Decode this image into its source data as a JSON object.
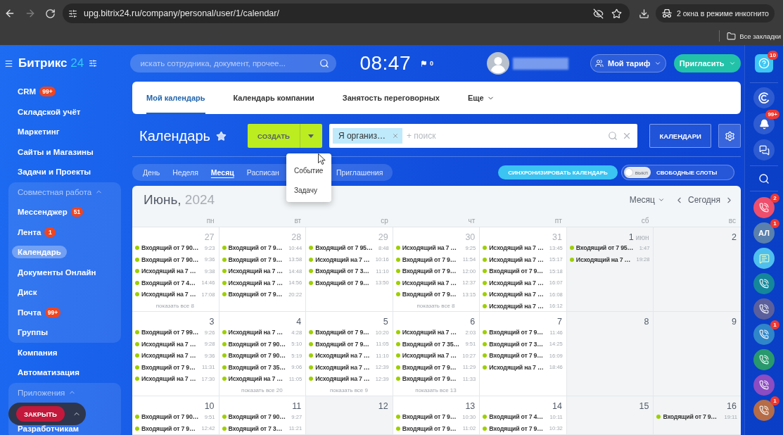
{
  "browser": {
    "url": "upg.bitrix24.ru/company/personal/user/1/calendar/",
    "incognito": "2 окна в режиме инкогнито",
    "bookmarks": "Все закладки"
  },
  "header": {
    "logo_name": "Битрикс",
    "logo_suffix": "24",
    "search_placeholder": "искать сотрудника, документ, прочее...",
    "clock": "08:47",
    "flag_count": "0",
    "tariff_button": "Мой тариф",
    "invite_button": "Пригласить"
  },
  "sidebar": {
    "items": [
      {
        "label": "CRM",
        "badge": "99+",
        "selected": false
      },
      {
        "label": "Складской учёт",
        "selected": false
      },
      {
        "label": "Маркетинг",
        "selected": false
      },
      {
        "label": "Сайты и Магазины",
        "selected": false
      },
      {
        "label": "Задачи и Проекты",
        "selected": false
      },
      {
        "kind": "group",
        "label": "Совместная работа",
        "expanded": true,
        "children": [
          {
            "label": "Мессенджер",
            "badge": "51",
            "selected": false
          },
          {
            "label": "Лента",
            "badge": "1",
            "selected": false
          },
          {
            "label": "Календарь",
            "selected": true
          },
          {
            "label": "Документы Онлайн",
            "selected": false
          },
          {
            "label": "Диск",
            "selected": false
          },
          {
            "label": "Почта",
            "badge": "99+",
            "selected": false
          },
          {
            "label": "Группы",
            "selected": false
          }
        ]
      },
      {
        "label": "Компания",
        "selected": false
      },
      {
        "label": "Автоматизация",
        "selected": false
      },
      {
        "kind": "group",
        "label": "Приложения",
        "expanded": true,
        "children": [
          {
            "label": "Разработчикам",
            "selected": false
          }
        ]
      }
    ]
  },
  "floating_bar": {
    "close_button": "ЗАКРЫТЬ"
  },
  "top_tabs": [
    {
      "kind": "tab",
      "label": "Мой календарь",
      "selected": true
    },
    {
      "kind": "tab",
      "label": "Календарь компании",
      "selected": false
    },
    {
      "kind": "tab",
      "label": "Занятость переговорных",
      "selected": false
    },
    {
      "kind": "more",
      "label": "Еще",
      "selected": false
    }
  ],
  "toolbar": {
    "title": "Календарь",
    "create_button": "СОЗДАТЬ",
    "create_menu": {
      "open": true,
      "items": [
        "Событие",
        "Задачу"
      ]
    },
    "filter": {
      "tags": [
        "Я организ…"
      ],
      "placeholder": "+ поиск"
    },
    "calendars_button": "КАЛЕНДАРИ"
  },
  "view_tabs": [
    {
      "label": "День",
      "selected": false
    },
    {
      "label": "Неделя",
      "selected": false
    },
    {
      "label": "Месяц",
      "selected": true
    },
    {
      "label": "Расписан",
      "selected": false
    },
    {
      "label": "Приглашения",
      "selected": false
    }
  ],
  "sync_button": "СИНХРОНИЗИРОВАТЬ КАЛЕНДАРЬ",
  "free_slots": {
    "switch_label": "выкл",
    "on": false,
    "label": "СВОБОДНЫЕ СЛОТЫ"
  },
  "calendar": {
    "month": "Июнь,",
    "year": "2024",
    "view_select": "Месяц",
    "today_button": "Сегодня",
    "weekdays": [
      "пн",
      "вт",
      "ср",
      "чт",
      "пт",
      "сб",
      "вс"
    ],
    "weeks": [
      [
        {
          "day": "27",
          "other_month": true,
          "day_off": false,
          "events": [
            {
              "title": "Входящий от 7 90…",
              "time": "9:23"
            },
            {
              "title": "Входящий от 7 90…",
              "time": "9:36"
            },
            {
              "title": "Исходящий на 7 …",
              "time": "9:38"
            },
            {
              "title": "Входящий от 7 4…",
              "time": "14:46"
            },
            {
              "title": "Исходящий на 7 …",
              "time": "17:08"
            }
          ],
          "more": "показать все 8"
        },
        {
          "day": "28",
          "other_month": true,
          "day_off": false,
          "events": [
            {
              "title": "Входящий от 7 9…",
              "time": "10:44"
            },
            {
              "title": "Входящий от 7 9…",
              "time": "13:58"
            },
            {
              "title": "Исходящий на 7 …",
              "time": "14:48"
            },
            {
              "title": "Исходящий на 7 …",
              "time": "14:56"
            },
            {
              "title": "Входящий от 7 9…",
              "time": "20:22"
            }
          ]
        },
        {
          "day": "29",
          "other_month": true,
          "day_off": false,
          "events": [
            {
              "title": "Входящий от 7 95…",
              "time": "8:48"
            },
            {
              "title": "Исходящий на 7 …",
              "time": "10:16"
            },
            {
              "title": "Входящий от 7 3…",
              "time": "11:10"
            },
            {
              "title": "Входящий от 7 9…",
              "time": "13:50"
            }
          ]
        },
        {
          "day": "30",
          "other_month": true,
          "day_off": false,
          "events": [
            {
              "title": "Исходящий на 7 …",
              "time": "9:25"
            },
            {
              "title": "Входящий от 7 9…",
              "time": "11:54"
            },
            {
              "title": "Входящий от 7 9…",
              "time": "12:00"
            },
            {
              "title": "Исходящий на 7 …",
              "time": "12:37"
            },
            {
              "title": "Входящий от 7 9…",
              "time": "13:15"
            }
          ],
          "more": "показать все 8"
        },
        {
          "day": "31",
          "other_month": true,
          "day_off": false,
          "events": [
            {
              "title": "Исходящий на 7 …",
              "time": "13:45"
            },
            {
              "title": "Исходящий на 7 …",
              "time": "15:17"
            },
            {
              "title": "Входящий от 7 9…",
              "time": "15:18"
            },
            {
              "title": "Исходящий на 7 …",
              "time": "16:07"
            },
            {
              "title": "Исходящий на 7 …",
              "time": "16:08"
            },
            {
              "title": "Исходящий на 7 …",
              "time": "16:12"
            }
          ]
        },
        {
          "day": "1",
          "month_label": "июн",
          "other_month": false,
          "day_off": true,
          "events": [
            {
              "title": "Входящий от 7 95…",
              "time": "1:47"
            },
            {
              "title": "Исходящий на 7 …",
              "time": "19:28"
            }
          ]
        },
        {
          "day": "2",
          "other_month": false,
          "day_off": true
        }
      ],
      [
        {
          "day": "3",
          "other_month": false,
          "day_off": false,
          "events": [
            {
              "title": "Входящий от 7 99…",
              "time": "9:26"
            },
            {
              "title": "Исходящий на 7 …",
              "time": "9:28"
            },
            {
              "title": "Исходящий на 7 …",
              "time": "9:36"
            },
            {
              "title": "Входящий от 7 9…",
              "time": "11:31"
            },
            {
              "title": "Исходящий на 7 …",
              "time": "17:30"
            }
          ]
        },
        {
          "day": "4",
          "other_month": false,
          "day_off": false,
          "events": [
            {
              "title": "Исходящий на 7 …",
              "time": "4:28"
            },
            {
              "title": "Входящий от 7 90…",
              "time": "5:10"
            },
            {
              "title": "Входящий от 7 90…",
              "time": "5:19"
            },
            {
              "title": "Входящий от 7 35…",
              "time": "9:06"
            },
            {
              "title": "Исходящий на 7 …",
              "time": "11:05"
            }
          ],
          "more": "показать все 20"
        },
        {
          "day": "5",
          "other_month": false,
          "day_off": false,
          "events": [
            {
              "title": "Входящий от 7 9…",
              "time": "10:20"
            },
            {
              "title": "Входящий от 7 9…",
              "time": "11:05"
            },
            {
              "title": "Исходящий на 7 …",
              "time": "11:10"
            },
            {
              "title": "Исходящий на 7 …",
              "time": "12:39"
            },
            {
              "title": "Исходящий на 7 …",
              "time": "12:39"
            }
          ],
          "more": "показать все 9"
        },
        {
          "day": "6",
          "other_month": false,
          "day_off": false,
          "events": [
            {
              "title": "Исходящий на 7 …",
              "time": "2:03"
            },
            {
              "title": "Входящий от 7 35…",
              "time": "9:51"
            },
            {
              "title": "Исходящий на 7 …",
              "time": "10:27"
            },
            {
              "title": "Входящий от 7 9…",
              "time": "11:29"
            },
            {
              "title": "Входящий от 7 9…",
              "time": "11:33"
            }
          ],
          "more": "показать все 13"
        },
        {
          "day": "7",
          "other_month": false,
          "day_off": false,
          "events": [
            {
              "title": "Входящий от 7 9…",
              "time": "11:46"
            },
            {
              "title": "Входящий от 7 3…",
              "time": "14:25"
            },
            {
              "title": "Входящий от 7 9…",
              "time": "16:09"
            },
            {
              "title": "Исходящий на 7 …",
              "time": "18:46"
            }
          ]
        },
        {
          "day": "8",
          "other_month": false,
          "day_off": true
        },
        {
          "day": "9",
          "other_month": false,
          "day_off": true
        }
      ],
      [
        {
          "day": "10",
          "other_month": false,
          "day_off": false,
          "events": [
            {
              "title": "Входящий от 7 90…",
              "time": "9:51"
            },
            {
              "title": "Входящий от 7 9…",
              "time": "12:42"
            }
          ]
        },
        {
          "day": "11",
          "other_month": false,
          "day_off": false,
          "events": [
            {
              "title": "Входящий от 7 90…",
              "time": "9:27"
            },
            {
              "title": "Входящий от 7 3…",
              "time": "11:21"
            }
          ]
        },
        {
          "day": "12",
          "other_month": false,
          "day_off": true
        },
        {
          "day": "13",
          "other_month": false,
          "day_off": false,
          "events": [
            {
              "title": "Входящий от 7 9…",
              "time": "10:30"
            },
            {
              "title": "Входящий от 7 9…",
              "time": "11:02"
            }
          ]
        },
        {
          "day": "14",
          "other_month": false,
          "day_off": false,
          "events": [
            {
              "title": "Входящий от 7 4…",
              "time": "10:11"
            },
            {
              "title": "Входящий от 7 9…",
              "time": "10:32"
            }
          ]
        },
        {
          "day": "15",
          "other_month": false,
          "day_off": true
        },
        {
          "day": "16",
          "other_month": false,
          "day_off": true,
          "events": [
            {
              "title": "Входящий от 7 9…",
              "time": "19:11"
            }
          ]
        }
      ]
    ]
  },
  "right_rail": {
    "help_badge": "10",
    "tools": [
      {
        "kind": "assistant"
      },
      {
        "kind": "bell",
        "badge": "99+"
      },
      {
        "kind": "chat"
      }
    ],
    "contacts": [
      {
        "kind": "phone",
        "color": "#ee4f6c",
        "badge": "2"
      },
      {
        "kind": "initials",
        "initials": "АЛ",
        "color": "#5a80ad",
        "badge": "1"
      },
      {
        "kind": "chat",
        "color": "#4fc0ee"
      },
      {
        "kind": "phone",
        "color": "#14879b"
      },
      {
        "kind": "phone",
        "color": "#5b5f9c"
      },
      {
        "kind": "phone",
        "color": "#2f86c9",
        "badge": "1"
      },
      {
        "kind": "phone",
        "color": "#28996c"
      },
      {
        "kind": "phone",
        "color": "#8c4cc2"
      },
      {
        "kind": "phone",
        "color": "#b56c47",
        "badge": "1"
      }
    ]
  }
}
